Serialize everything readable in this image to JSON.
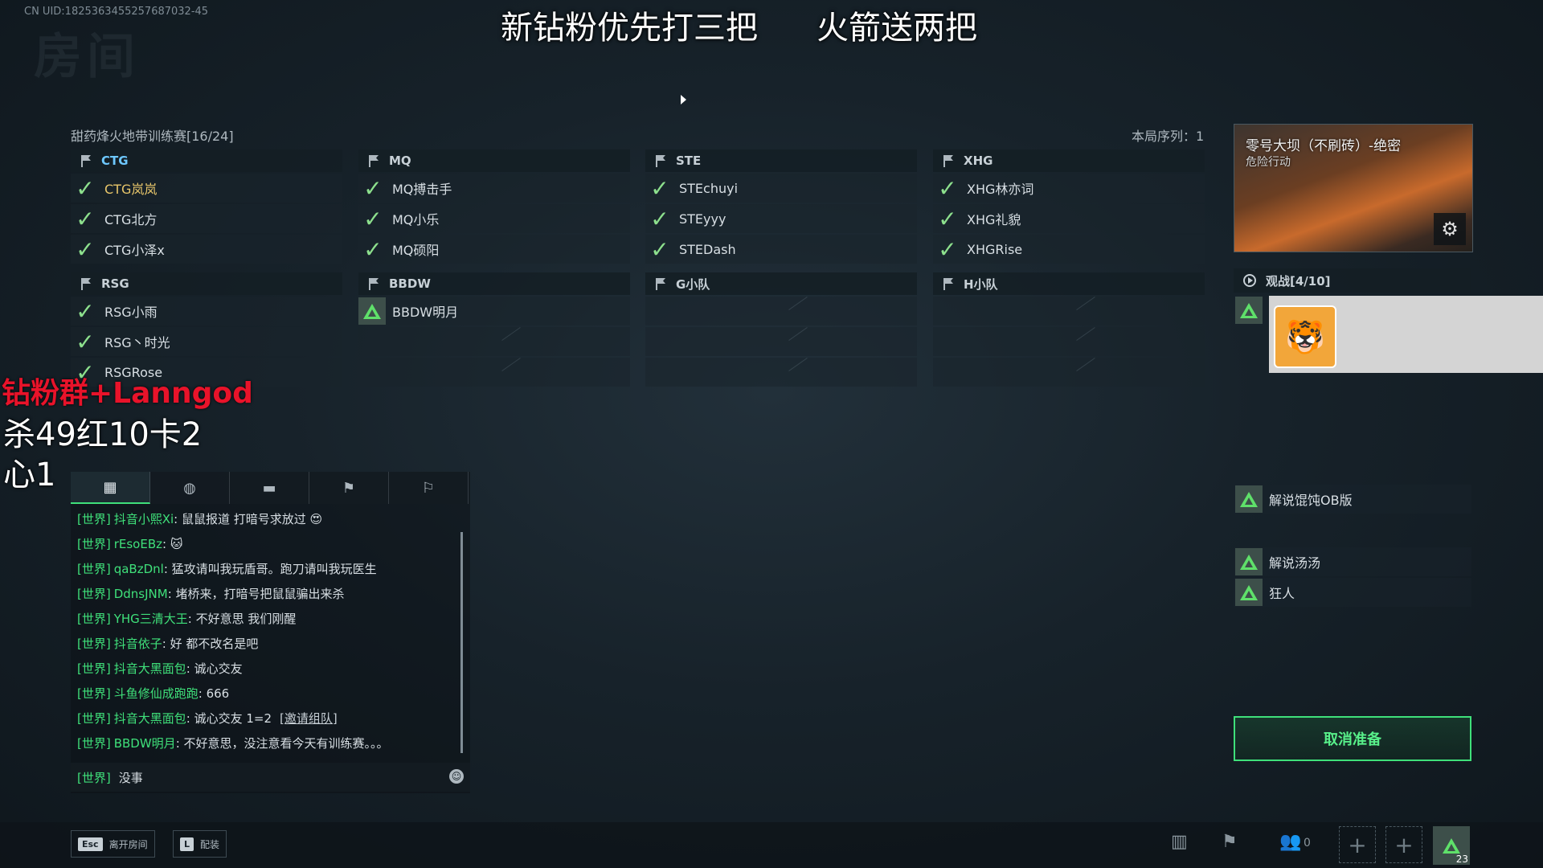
{
  "uid": "CN UID:1825363455257687032-45",
  "banner": {
    "left": "新钻粉优先打三把",
    "right": "火箭送两把"
  },
  "room": {
    "title": "甜药烽火地带训练赛[16/24]",
    "round_seq": "本局序列：1"
  },
  "teams": [
    {
      "name": "CTG",
      "players": [
        {
          "name": "CTG岚岚",
          "ready": true,
          "self": true
        },
        {
          "name": "CTG北方",
          "ready": true
        },
        {
          "name": "CTG小泽x",
          "ready": true
        }
      ]
    },
    {
      "name": "MQ",
      "players": [
        {
          "name": "MQ搏击手",
          "ready": true
        },
        {
          "name": "MQ小乐",
          "ready": true
        },
        {
          "name": "MQ硕阳",
          "ready": true
        }
      ]
    },
    {
      "name": "STE",
      "players": [
        {
          "name": "STEchuyi",
          "ready": true
        },
        {
          "name": "STEyyy",
          "ready": true
        },
        {
          "name": "STEDash",
          "ready": true
        }
      ]
    },
    {
      "name": "XHG",
      "players": [
        {
          "name": "XHG林亦词",
          "ready": true
        },
        {
          "name": "XHG礼貌",
          "ready": true
        },
        {
          "name": "XHGRise",
          "ready": true
        }
      ]
    },
    {
      "name": "RSG",
      "players": [
        {
          "name": "RSG小雨",
          "ready": true
        },
        {
          "name": "RSG丶时光",
          "ready": true
        },
        {
          "name": "RSGRose",
          "ready": true
        }
      ]
    },
    {
      "name": "BBDW",
      "players": [
        {
          "name": "BBDW明月",
          "ready": false
        }
      ]
    },
    {
      "name": "G小队",
      "players": []
    },
    {
      "name": "H小队",
      "players": []
    }
  ],
  "map": {
    "title": "零号大坝（不刷砖）-绝密",
    "subtitle": "危险行动"
  },
  "spectators": {
    "header": "观战[4/10]",
    "names": [
      "解说馄饨OB版",
      "解说汤汤",
      "狂人"
    ]
  },
  "ready_button": "取消准备",
  "overlay": {
    "red": "钻粉群+Lanngod",
    "line1": "杀49红10卡2",
    "line2": "心1"
  },
  "chat": {
    "channel": "[世界]",
    "messages": [
      {
        "user": "抖音小熙Xi",
        "text": "鼠鼠报道 打暗号求放过 😍"
      },
      {
        "user": "rEsoEBz",
        "text": "🐱"
      },
      {
        "user": "qaBzDnl",
        "text": "猛攻请叫我玩盾哥。跑刀请叫我玩医生"
      },
      {
        "user": "DdnsJNM",
        "text": "堵桥来，打暗号把鼠鼠骗出来杀"
      },
      {
        "user": "YHG三清大王",
        "text": "不好意思 我们刚醒"
      },
      {
        "user": "抖音依子",
        "text": "好 都不改名是吧"
      },
      {
        "user": "抖音大黑面包",
        "text": "诚心交友"
      },
      {
        "user": "斗鱼修仙成跑跑",
        "text": "666"
      },
      {
        "user": "抖音大黑面包",
        "text": "诚心交友 1=2",
        "link": "[邀请组队]"
      },
      {
        "user": "BBDW明月",
        "text": "不好意思，没注意看今天有训练赛。。。"
      }
    ],
    "input": {
      "channel": "[世界]",
      "value": "没事"
    }
  },
  "bottom": {
    "esc_key": "Esc",
    "esc_label": "离开房间",
    "l_key": "L",
    "l_label": "配装",
    "friends_count": "0",
    "self_count": "23"
  },
  "colors": {
    "accent_green": "#3fe07a",
    "ready_check": "#8de08d",
    "self_name": "#e8c66a",
    "overlay_red": "#e8132a"
  }
}
